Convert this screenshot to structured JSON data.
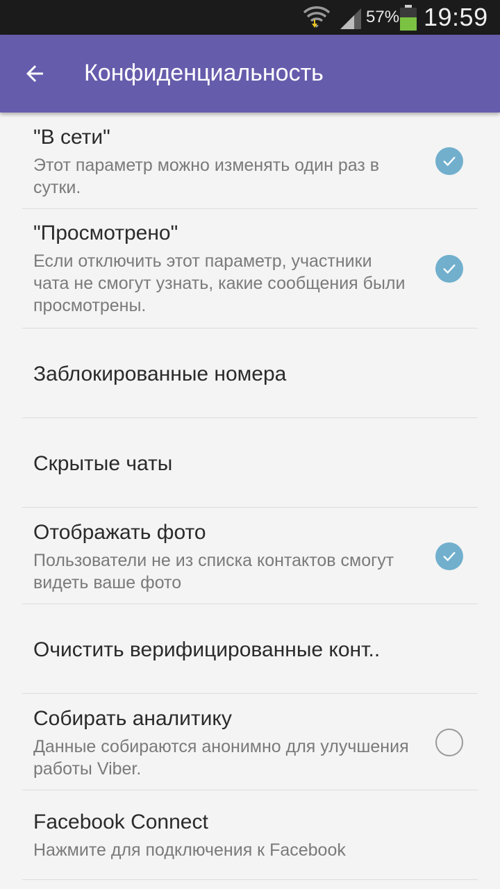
{
  "status_bar": {
    "battery_percent": "57%",
    "time": "19:59",
    "icons": [
      "wifi-icon",
      "signal-icon",
      "battery-icon"
    ],
    "battery_level": 0.57,
    "battery_color": "#7cc242"
  },
  "toolbar": {
    "title": "Конфиденциальность",
    "back_icon": "arrow-back-icon",
    "background": "#665cac"
  },
  "settings": [
    {
      "title": "\"В сети\"",
      "subtitle": "Этот параметр можно изменять один раз в сутки.",
      "checkbox": "checked"
    },
    {
      "title": "\"Просмотрено\"",
      "subtitle": "Если отключить этот параметр, участники чата не смогут узнать, какие сообщения были просмотрены.",
      "checkbox": "checked"
    },
    {
      "title": "Заблокированные номера"
    },
    {
      "title": "Скрытые чаты"
    },
    {
      "title": "Отображать фото",
      "subtitle": "Пользователи не из списка контактов смогут видеть ваше фото",
      "checkbox": "checked"
    },
    {
      "title": "Очистить верифицированные конт.."
    },
    {
      "title": "Собирать аналитику",
      "subtitle": "Данные собираются анонимно для улучшения работы Viber.",
      "checkbox": "unchecked"
    },
    {
      "title": "Facebook Connect",
      "subtitle": "Нажмите для подключения к Facebook"
    }
  ],
  "colors": {
    "check_fill": "#71afcd",
    "divider": "#dcdcdc",
    "background": "#f4f4f4"
  }
}
